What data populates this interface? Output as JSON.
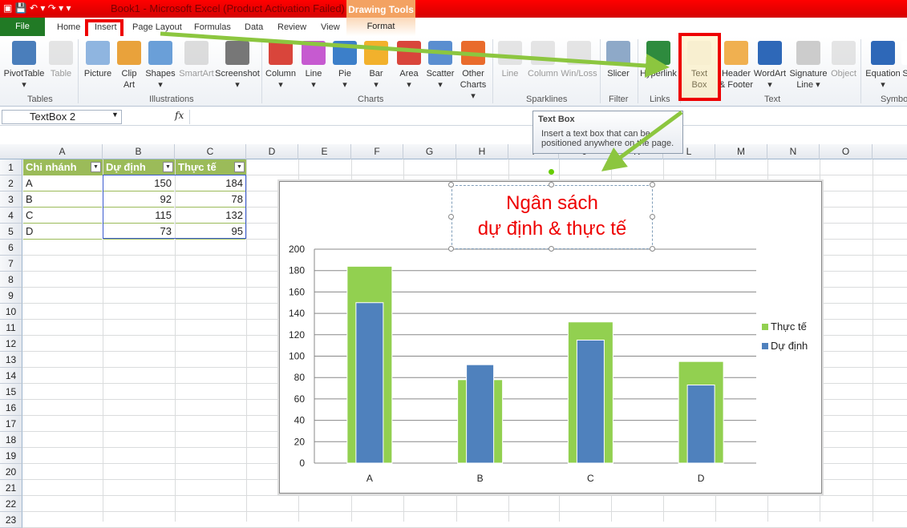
{
  "titlebar": {
    "title": "Book1 - Microsoft Excel (Product Activation Failed)",
    "context": "Drawing Tools"
  },
  "tabs": [
    "File",
    "Home",
    "Insert",
    "Page Layout",
    "Formulas",
    "Data",
    "Review",
    "View",
    "Format"
  ],
  "ribbon": {
    "buttons": [
      {
        "l": "PivotTable",
        "l2": "▾",
        "x": 4,
        "w": 52,
        "c": "#4a7ebb"
      },
      {
        "l": "Table",
        "x": 60,
        "w": 32,
        "c": "#ccc",
        "dis": true
      },
      {
        "l": "Picture",
        "x": 102,
        "w": 40,
        "c": "#8fb5e0"
      },
      {
        "l": "Clip",
        "l2": "Art",
        "x": 146,
        "w": 30,
        "c": "#e9a23b"
      },
      {
        "l": "Shapes",
        "l2": "▾",
        "x": 180,
        "w": 40,
        "c": "#6a9fd8"
      },
      {
        "l": "SmartArt",
        "x": 222,
        "w": 46,
        "c": "#bbb",
        "dis": true
      },
      {
        "l": "Screenshot",
        "l2": "▾",
        "x": 268,
        "w": 56,
        "c": "#777"
      },
      {
        "l": "Column",
        "l2": "▾",
        "x": 330,
        "w": 40,
        "c": "#d9453b"
      },
      {
        "l": "Line",
        "l2": "▾",
        "x": 374,
        "w": 34,
        "c": "#c65ad0"
      },
      {
        "l": "Pie",
        "l2": "▾",
        "x": 414,
        "w": 32,
        "c": "#3c7fc9"
      },
      {
        "l": "Bar",
        "l2": "▾",
        "x": 452,
        "w": 34,
        "c": "#f2b12c"
      },
      {
        "l": "Area",
        "l2": "▾",
        "x": 492,
        "w": 36,
        "c": "#d9453b"
      },
      {
        "l": "Scatter",
        "l2": "▾",
        "x": 530,
        "w": 38,
        "c": "#5a8ed0"
      },
      {
        "l": "Other",
        "l2": "Charts ▾",
        "x": 570,
        "w": 40,
        "c": "#e96b2c"
      },
      {
        "l": "Line",
        "x": 620,
        "w": 32,
        "c": "#ccc",
        "dis": true
      },
      {
        "l": "Column",
        "x": 656,
        "w": 42,
        "c": "#ccc",
        "dis": true
      },
      {
        "l": "Win/Loss",
        "x": 698,
        "w": 48,
        "c": "#ccc",
        "dis": true
      },
      {
        "l": "Slicer",
        "x": 752,
        "w": 38,
        "c": "#8ea9c8"
      },
      {
        "l": "Hyperlink",
        "x": 796,
        "w": 50,
        "c": "#2e8b3e"
      },
      {
        "l": "Text",
        "l2": "Box",
        "x": 850,
        "w": 44,
        "c": "#f5f5f5"
      },
      {
        "l": "Header",
        "l2": "& Footer",
        "x": 896,
        "w": 44,
        "c": "#f0b050"
      },
      {
        "l": "WordArt",
        "l2": "▾",
        "x": 938,
        "w": 44,
        "c": "#2e68b8"
      },
      {
        "l": "Signature",
        "l2": "Line ▾",
        "x": 984,
        "w": 48,
        "c": "#ccc"
      },
      {
        "l": "Object",
        "x": 1032,
        "w": 40,
        "c": "#ccc",
        "dis": true
      },
      {
        "l": "Equation",
        "l2": "▾",
        "x": 1078,
        "w": 46,
        "c": "#2e68b8"
      },
      {
        "l": "S",
        "x": 1124,
        "w": 10,
        "c": "#fff"
      }
    ],
    "groups": [
      {
        "l": "Tables",
        "x": 34
      },
      {
        "l": "Illustrations",
        "x": 186
      },
      {
        "l": "Charts",
        "x": 446
      },
      {
        "l": "Sparklines",
        "x": 656
      },
      {
        "l": "Filter",
        "x": 759
      },
      {
        "l": "Links",
        "x": 810
      },
      {
        "l": "Text",
        "x": 953
      },
      {
        "l": "Symbo",
        "x": 1098
      }
    ]
  },
  "namebox": "TextBox 2",
  "fx": "fx",
  "tooltip": {
    "title": "Text Box",
    "body": "Insert a text box that can be positioned anywhere on the page."
  },
  "columns": [
    "A",
    "B",
    "C",
    "D",
    "E",
    "F",
    "G",
    "H",
    "I",
    "J",
    "K",
    "L",
    "M",
    "N",
    "O"
  ],
  "rows": [
    "1",
    "2",
    "3",
    "4",
    "5",
    "6",
    "7",
    "8",
    "9",
    "10",
    "11",
    "12",
    "13",
    "14",
    "15",
    "16",
    "17",
    "18",
    "19",
    "20",
    "21",
    "22",
    "23"
  ],
  "table": {
    "headers": [
      "Chi nhánh",
      "Dự định",
      "Thực tế"
    ],
    "rows": [
      [
        "A",
        "150",
        "184"
      ],
      [
        "B",
        "92",
        "78"
      ],
      [
        "C",
        "115",
        "132"
      ],
      [
        "D",
        "73",
        "95"
      ]
    ]
  },
  "chart_data": {
    "type": "bar",
    "title_line1": "Ngân sách",
    "title_line2": "dự định & thực tế",
    "categories": [
      "A",
      "B",
      "C",
      "D"
    ],
    "series": [
      {
        "name": "Thực tế",
        "values": [
          184,
          78,
          132,
          95
        ],
        "color": "#92d050"
      },
      {
        "name": "Dự định",
        "values": [
          150,
          92,
          115,
          73
        ],
        "color": "#4f81bd"
      }
    ],
    "ylim": [
      0,
      200
    ],
    "yticks": [
      "0",
      "20",
      "40",
      "60",
      "80",
      "100",
      "120",
      "140",
      "160",
      "180",
      "200"
    ],
    "legend": "right"
  }
}
